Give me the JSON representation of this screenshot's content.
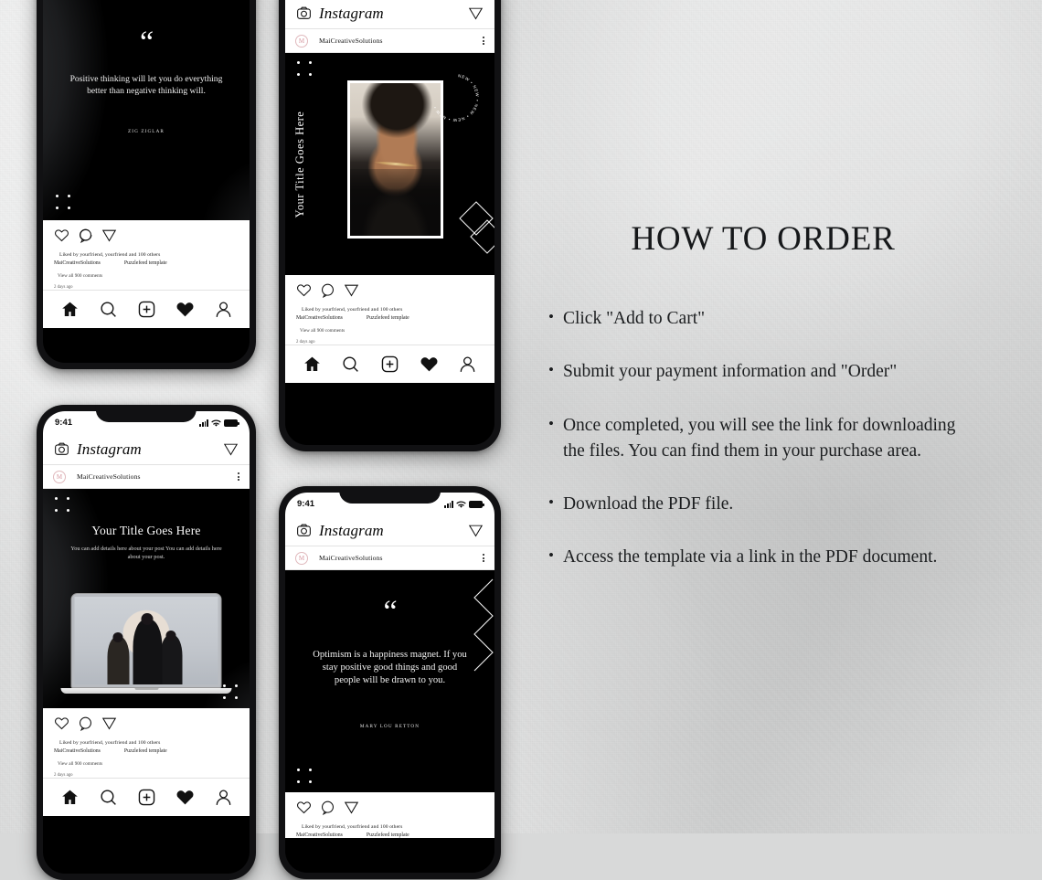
{
  "background": {
    "color": "#d8d9d9"
  },
  "how_to_order": {
    "title": "HOW TO ORDER",
    "bullet_glyph": "•",
    "steps": [
      "Click \"Add to Cart\"",
      "Submit your payment information and \"Order\"",
      "Once completed, you will see the link for downloading the files. You can find them in your purchase area.",
      "Download the PDF file.",
      "Access the template via a link in the PDF document."
    ]
  },
  "instagram": {
    "status_time": "9:41",
    "app_name": "Instagram",
    "account_name": "MaiCreativeSolutions",
    "avatar_letter": "M",
    "likes_text": "Liked  by yourfriend, yourfriend and 100 others",
    "caption_account": "MaiCreativeSolutions",
    "caption_text": "Puzzlefeed template",
    "comments_text": "View all 900 comments",
    "time_ago": "2 days ago",
    "tabs": [
      "home-icon",
      "search-icon",
      "add-post-icon",
      "heart-icon",
      "profile-icon"
    ],
    "actions": [
      "like-icon",
      "comment-icon",
      "share-icon"
    ]
  },
  "posts": {
    "quote_top_left": {
      "quote_mark": "“",
      "text": "Positive thinking will let you do everything better than negative thinking will.",
      "author": "ZIG ZIGLAR"
    },
    "product_mid": {
      "vertical_title": "Your Title Goes Here",
      "badge_text": "NEW • NEW • NEW • NEW • NEW •"
    },
    "laptop_bottom_left": {
      "title": "Your Title Goes Here",
      "subtitle": "You can add details here about your post You can add details here about your post."
    },
    "quote_bottom_right": {
      "quote_mark": "“",
      "text": "Optimism is a happiness magnet. If you stay positive good things and good people will be drawn to you.",
      "author": "MARY LOU RETTON"
    }
  }
}
